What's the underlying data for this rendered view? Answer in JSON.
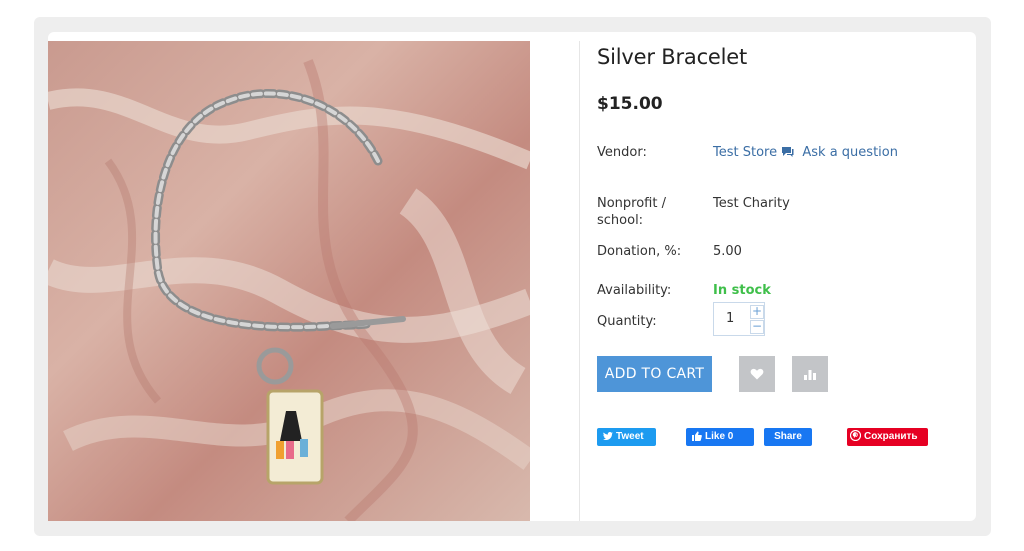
{
  "product": {
    "title": "Silver Bracelet",
    "price": "$15.00",
    "vendor_label": "Vendor:",
    "vendor_name": "Test Store",
    "ask_question": "Ask a question",
    "nonprofit_label": "Nonprofit / school:",
    "nonprofit_value": "Test Charity",
    "donation_label": "Donation, %:",
    "donation_value": "5.00",
    "availability_label": "Availability:",
    "availability_value": "In stock",
    "quantity_label": "Quantity:",
    "quantity_value": "1",
    "qty_plus": "+",
    "qty_minus": "−"
  },
  "actions": {
    "add_to_cart": "ADD TO CART",
    "wishlist_icon": "heart-icon",
    "compare_icon": "bar-chart-icon"
  },
  "social": {
    "tweet": "Tweet",
    "fb_like": "Like 0",
    "fb_share": "Share",
    "pinterest": "Сохранить"
  },
  "colors": {
    "accent": "#4e95d8",
    "link": "#3b6ea5",
    "in_stock": "#3fbf4a",
    "twitter": "#1d9bf0",
    "facebook": "#1877f2",
    "pinterest": "#e60023"
  }
}
